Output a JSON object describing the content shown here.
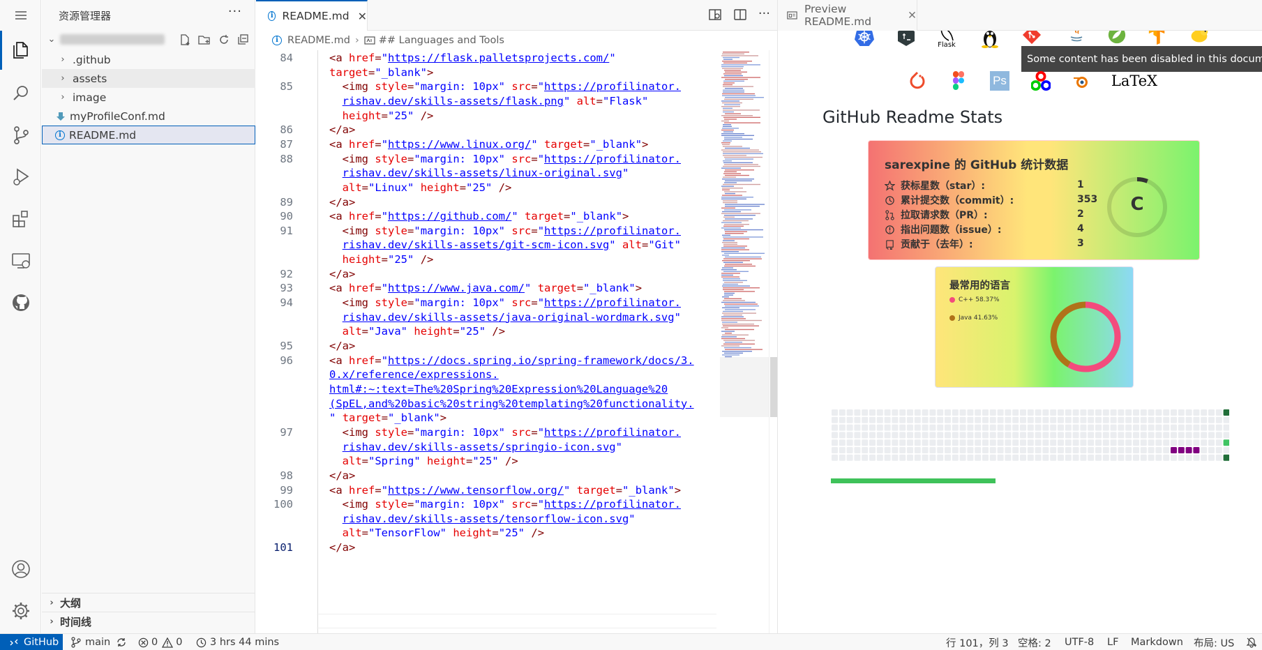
{
  "sidebar": {
    "title": "资源管理器",
    "items": [
      {
        "label": ".github",
        "type": "folder"
      },
      {
        "label": "assets",
        "type": "folder"
      },
      {
        "label": "image",
        "type": "folder"
      },
      {
        "label": "myProfileConf.md",
        "type": "file-down"
      },
      {
        "label": "README.md",
        "type": "file-info"
      }
    ],
    "outline_label": "大纲",
    "timeline_label": "时间线"
  },
  "editor": {
    "tab_label": "README.md",
    "breadcrumb": {
      "file": "README.md",
      "section": "## Languages and Tools"
    },
    "lines": [
      {
        "n": "84",
        "html": "<span class='t'>&lt;a</span> <span class='a'>href</span>=<span class='s'>\"</span><span class='u'>https://flask.palletsprojects.com/</span><span class='s'>\"</span>"
      },
      {
        "n": "",
        "html": "<span class='a'>target</span>=<span class='s'>\"_blank\"</span><span class='t'>&gt;</span>"
      },
      {
        "n": "85",
        "html": "  <span class='t'>&lt;img</span> <span class='a'>style</span>=<span class='s'>\"margin: 10px\"</span> <span class='a'>src</span>=<span class='s'>\"</span><span class='u'>https://profilinator.</span>"
      },
      {
        "n": "",
        "html": "  <span class='u'>rishav.dev/skills-assets/flask.png</span><span class='s'>\"</span> <span class='a'>alt</span>=<span class='s'>\"Flask\"</span>"
      },
      {
        "n": "",
        "html": "  <span class='a'>height</span>=<span class='s'>\"25\"</span> <span class='t'>/&gt;</span>"
      },
      {
        "n": "86",
        "html": "<span class='t'>&lt;/a&gt;</span>"
      },
      {
        "n": "87",
        "html": "<span class='t'>&lt;a</span> <span class='a'>href</span>=<span class='s'>\"</span><span class='u'>https://www.linux.org/</span><span class='s'>\"</span> <span class='a'>target</span>=<span class='s'>\"_blank\"</span><span class='t'>&gt;</span>"
      },
      {
        "n": "88",
        "html": "  <span class='t'>&lt;img</span> <span class='a'>style</span>=<span class='s'>\"margin: 10px\"</span> <span class='a'>src</span>=<span class='s'>\"</span><span class='u'>https://profilinator.</span>"
      },
      {
        "n": "",
        "html": "  <span class='u'>rishav.dev/skills-assets/linux-original.svg</span><span class='s'>\"</span>"
      },
      {
        "n": "",
        "html": "  <span class='a'>alt</span>=<span class='s'>\"Linux\"</span> <span class='a'>height</span>=<span class='s'>\"25\"</span> <span class='t'>/&gt;</span>"
      },
      {
        "n": "89",
        "html": "<span class='t'>&lt;/a&gt;</span>"
      },
      {
        "n": "90",
        "html": "<span class='t'>&lt;a</span> <span class='a'>href</span>=<span class='s'>\"</span><span class='u'>https://github.com/</span><span class='s'>\"</span> <span class='a'>target</span>=<span class='s'>\"_blank\"</span><span class='t'>&gt;</span>"
      },
      {
        "n": "91",
        "html": "  <span class='t'>&lt;img</span> <span class='a'>style</span>=<span class='s'>\"margin: 10px\"</span> <span class='a'>src</span>=<span class='s'>\"</span><span class='u'>https://profilinator.</span>"
      },
      {
        "n": "",
        "html": "  <span class='u'>rishav.dev/skills-assets/git-scm-icon.svg</span><span class='s'>\"</span> <span class='a'>alt</span>=<span class='s'>\"Git\"</span>"
      },
      {
        "n": "",
        "html": "  <span class='a'>height</span>=<span class='s'>\"25\"</span> <span class='t'>/&gt;</span>"
      },
      {
        "n": "92",
        "html": "<span class='t'>&lt;/a&gt;</span>"
      },
      {
        "n": "93",
        "html": "<span class='t'>&lt;a</span> <span class='a'>href</span>=<span class='s'>\"</span><span class='u'>https://www.java.com/</span><span class='s'>\"</span> <span class='a'>target</span>=<span class='s'>\"_blank\"</span><span class='t'>&gt;</span>"
      },
      {
        "n": "94",
        "html": "  <span class='t'>&lt;img</span> <span class='a'>style</span>=<span class='s'>\"margin: 10px\"</span> <span class='a'>src</span>=<span class='s'>\"</span><span class='u'>https://profilinator.</span>"
      },
      {
        "n": "",
        "html": "  <span class='u'>rishav.dev/skills-assets/java-original-wordmark.svg</span><span class='s'>\"</span>"
      },
      {
        "n": "",
        "html": "  <span class='a'>alt</span>=<span class='s'>\"Java\"</span> <span class='a'>height</span>=<span class='s'>\"25\"</span> <span class='t'>/&gt;</span>"
      },
      {
        "n": "95",
        "html": "<span class='t'>&lt;/a&gt;</span>"
      },
      {
        "n": "96",
        "html": "<span class='t'>&lt;a</span> <span class='a'>href</span>=<span class='s'>\"</span><span class='u'>https://docs.spring.io/spring-framework/docs/3.</span>"
      },
      {
        "n": "",
        "html": "<span class='u'>0.x/reference/expressions.</span>"
      },
      {
        "n": "",
        "html": "<span class='u'>html#:~:text=The%20Spring%20Expression%20Language%20</span>"
      },
      {
        "n": "",
        "html": "<span class='u'>(SpEL,and%20basic%20string%20templating%20functionality.</span>"
      },
      {
        "n": "",
        "html": "<span class='s'>\"</span> <span class='a'>target</span>=<span class='s'>\"_blank\"</span><span class='t'>&gt;</span>"
      },
      {
        "n": "97",
        "html": "  <span class='t'>&lt;img</span> <span class='a'>style</span>=<span class='s'>\"margin: 10px\"</span> <span class='a'>src</span>=<span class='s'>\"</span><span class='u'>https://profilinator.</span>"
      },
      {
        "n": "",
        "html": "  <span class='u'>rishav.dev/skills-assets/springio-icon.svg</span><span class='s'>\"</span>"
      },
      {
        "n": "",
        "html": "  <span class='a'>alt</span>=<span class='s'>\"Spring\"</span> <span class='a'>height</span>=<span class='s'>\"25\"</span> <span class='t'>/&gt;</span>"
      },
      {
        "n": "98",
        "html": "<span class='t'>&lt;/a&gt;</span>"
      },
      {
        "n": "99",
        "html": "<span class='t'>&lt;a</span> <span class='a'>href</span>=<span class='s'>\"</span><span class='u'>https://www.tensorflow.org/</span><span class='s'>\"</span> <span class='a'>target</span>=<span class='s'>\"_blank\"</span><span class='t'>&gt;</span>"
      },
      {
        "n": "100",
        "html": "  <span class='t'>&lt;img</span> <span class='a'>style</span>=<span class='s'>\"margin: 10px\"</span> <span class='a'>src</span>=<span class='s'>\"</span><span class='u'>https://profilinator.</span>"
      },
      {
        "n": "",
        "html": "  <span class='u'>rishav.dev/skills-assets/tensorflow-icon.svg</span><span class='s'>\"</span>"
      },
      {
        "n": "",
        "html": "  <span class='a'>alt</span>=<span class='s'>\"TensorFlow\"</span> <span class='a'>height</span>=<span class='s'>\"25\"</span> <span class='t'>/&gt;</span>"
      },
      {
        "n": "101",
        "html": "<span class='t'>&lt;/a&gt;</span>"
      }
    ]
  },
  "preview": {
    "tab_label": "Preview README.md",
    "tooltip": "Some content has been disabled in this document",
    "skills_row1": [
      "kubernetes-icon",
      "bash-icon",
      "flask-icon",
      "linux-icon",
      "git-icon",
      "java-icon",
      "spring-icon",
      "tensorflow-icon",
      "hadoop-icon"
    ],
    "flask_label": "Flask",
    "skills_row2": [
      "pytorch-icon",
      "figma-icon",
      "photoshop-icon",
      "opencv-icon",
      "blender-icon",
      "latex-icon"
    ],
    "ps_label": "Ps",
    "latex_label": "LaTeX",
    "heading": "GitHub Readme Stats",
    "stats": {
      "title": "sarexpine 的 GitHub 统计数据",
      "rows": [
        {
          "label": "获标星数（star）:",
          "value": "1",
          "icon": "star-icon"
        },
        {
          "label": "累计提交数（commit）:",
          "value": "353",
          "icon": "history-icon"
        },
        {
          "label": "拉取请求数（PR）:",
          "value": "2",
          "icon": "pull-request-icon"
        },
        {
          "label": "指出问题数（issue）:",
          "value": "4",
          "icon": "issue-icon"
        },
        {
          "label": "贡献于（去年）:",
          "value": "3",
          "icon": "repo-icon"
        }
      ],
      "rank": "C",
      "rank_progress": 0.06
    },
    "languages": {
      "title": "最常用的语言",
      "items": [
        {
          "label": "C++ 58.37%",
          "percent": 58.37,
          "color": "#f34b7d"
        },
        {
          "label": "Java 41.63%",
          "percent": 41.63,
          "color": "#b07219"
        }
      ]
    }
  },
  "status": {
    "remote": "GitHub",
    "branch": "main",
    "errors": "0",
    "warnings": "0",
    "time": "3 hrs 44 mins",
    "position": "行 101，列 3",
    "spaces": "空格: 2",
    "encoding": "UTF-8",
    "eol": "LF",
    "language": "Markdown",
    "layout": "布局: US"
  }
}
